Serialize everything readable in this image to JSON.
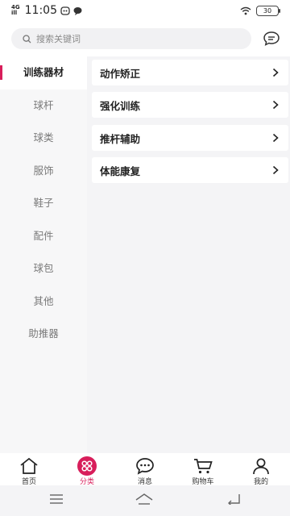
{
  "status_bar": {
    "network": "4G",
    "network_sub": "ill",
    "time": "11:05",
    "battery": "30"
  },
  "search": {
    "placeholder": "搜索关键词",
    "value": ""
  },
  "sidebar": {
    "items": [
      {
        "label": "训练器材",
        "active": true
      },
      {
        "label": "球杆",
        "active": false
      },
      {
        "label": "球类",
        "active": false
      },
      {
        "label": "服饰",
        "active": false
      },
      {
        "label": "鞋子",
        "active": false
      },
      {
        "label": "配件",
        "active": false
      },
      {
        "label": "球包",
        "active": false
      },
      {
        "label": "其他",
        "active": false
      },
      {
        "label": "助推器",
        "active": false
      }
    ]
  },
  "content": {
    "rows": [
      {
        "label": "动作矫正"
      },
      {
        "label": "强化训练"
      },
      {
        "label": "推杆辅助"
      },
      {
        "label": "体能康复"
      }
    ]
  },
  "tabbar": {
    "tabs": [
      {
        "label": "首页",
        "icon": "home-icon"
      },
      {
        "label": "分类",
        "icon": "category-icon",
        "active": true
      },
      {
        "label": "消息",
        "icon": "message-icon"
      },
      {
        "label": "购物车",
        "icon": "cart-icon"
      },
      {
        "label": "我的",
        "icon": "profile-icon"
      }
    ]
  },
  "colors": {
    "accent": "#d81e5b",
    "sidebar_bg": "#f7f7f8",
    "content_bg": "#f4f4f6"
  }
}
